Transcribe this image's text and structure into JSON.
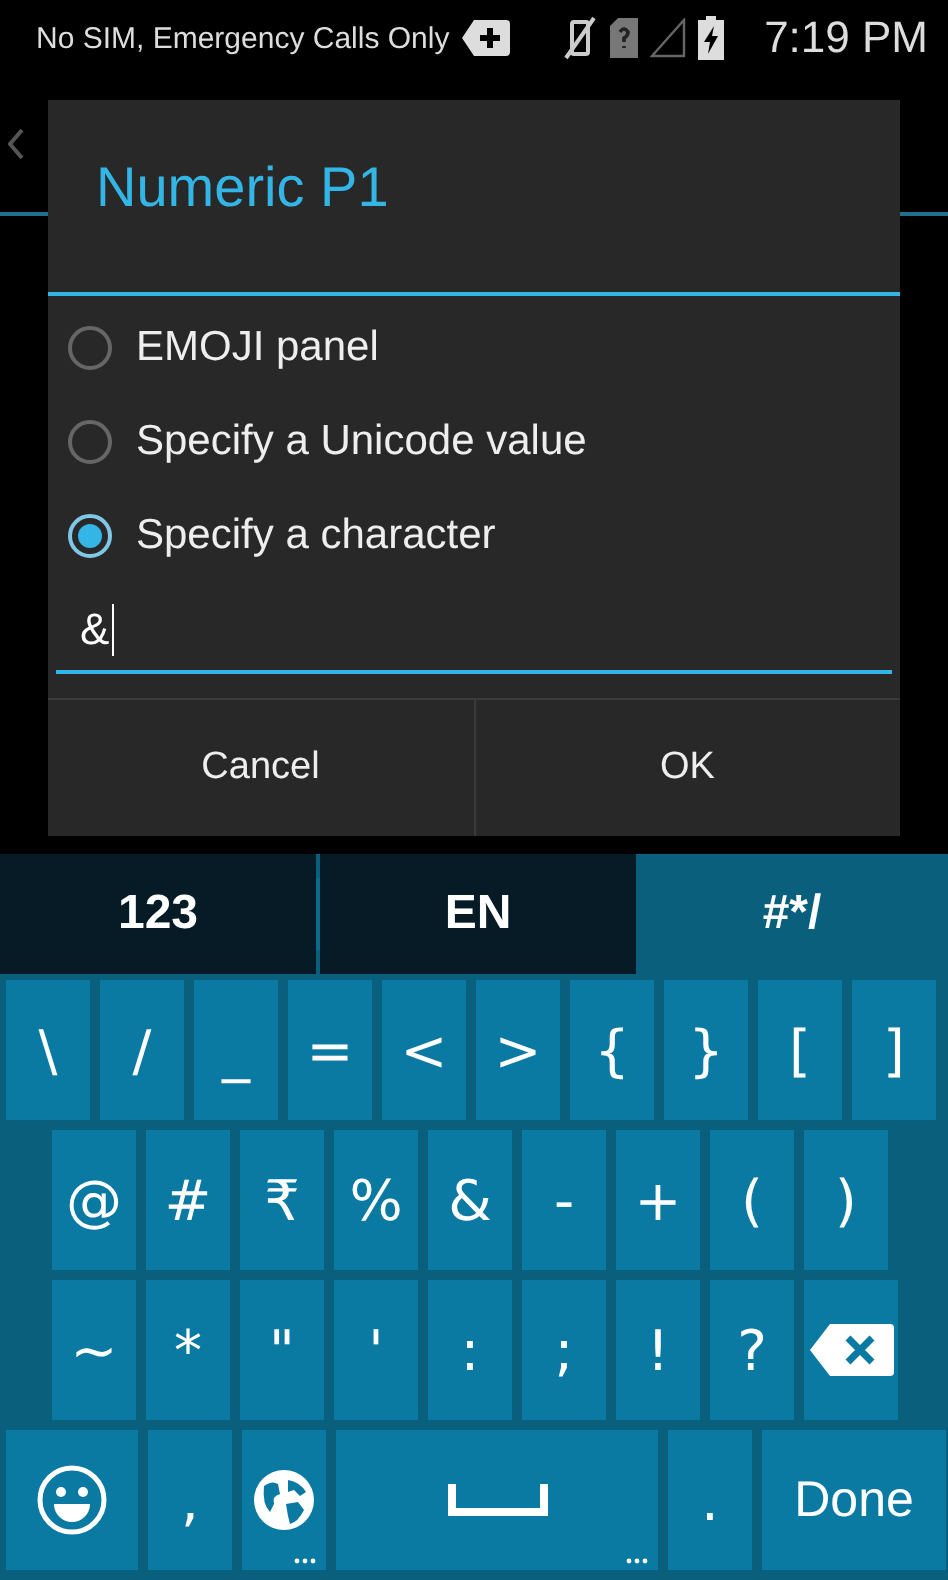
{
  "status_bar": {
    "carrier": "No SIM, Emergency Calls Only",
    "time": "7:19 PM"
  },
  "dialog": {
    "title": "Numeric P1",
    "options": [
      {
        "label": "EMOJI panel",
        "selected": false
      },
      {
        "label": "Specify a Unicode value",
        "selected": false
      },
      {
        "label": "Specify a character",
        "selected": true
      }
    ],
    "input": {
      "value": "&"
    },
    "buttons": [
      "Cancel",
      "OK"
    ]
  },
  "keyboard": {
    "tabs": [
      {
        "label": "123",
        "selected": false
      },
      {
        "label": "EN",
        "selected": false
      },
      {
        "label": "#*/",
        "selected": true
      }
    ],
    "rows": [
      {
        "keys": [
          {
            "kind": "char",
            "label": "\\"
          },
          {
            "kind": "char",
            "label": "/"
          },
          {
            "kind": "char",
            "label": "_"
          },
          {
            "kind": "char",
            "label": "="
          },
          {
            "kind": "char",
            "label": "<"
          },
          {
            "kind": "char",
            "label": ">"
          },
          {
            "kind": "char",
            "label": "{"
          },
          {
            "kind": "char",
            "label": "}"
          },
          {
            "kind": "char",
            "label": "["
          },
          {
            "kind": "char",
            "label": "]"
          }
        ]
      },
      {
        "keys": [
          {
            "kind": "char",
            "label": "@"
          },
          {
            "kind": "char",
            "label": "#"
          },
          {
            "kind": "char",
            "label": "₹"
          },
          {
            "kind": "char",
            "label": "%"
          },
          {
            "kind": "char",
            "label": "&"
          },
          {
            "kind": "char",
            "label": "-"
          },
          {
            "kind": "char",
            "label": "+"
          },
          {
            "kind": "char",
            "label": "("
          },
          {
            "kind": "char",
            "label": ")"
          }
        ]
      },
      {
        "keys": [
          {
            "kind": "char",
            "label": "~"
          },
          {
            "kind": "char",
            "label": "*"
          },
          {
            "kind": "char",
            "label": "\""
          },
          {
            "kind": "char",
            "label": "'"
          },
          {
            "kind": "char",
            "label": ":"
          },
          {
            "kind": "char",
            "label": ";"
          },
          {
            "kind": "char",
            "label": "!"
          },
          {
            "kind": "char",
            "label": "?"
          },
          {
            "kind": "backspace"
          }
        ]
      },
      {
        "keys": [
          {
            "kind": "emoji"
          },
          {
            "kind": "char",
            "label": ","
          },
          {
            "kind": "globe",
            "more": true
          },
          {
            "kind": "space",
            "more": true
          },
          {
            "kind": "char",
            "label": "."
          },
          {
            "kind": "done",
            "label": "Done"
          }
        ]
      }
    ]
  }
}
